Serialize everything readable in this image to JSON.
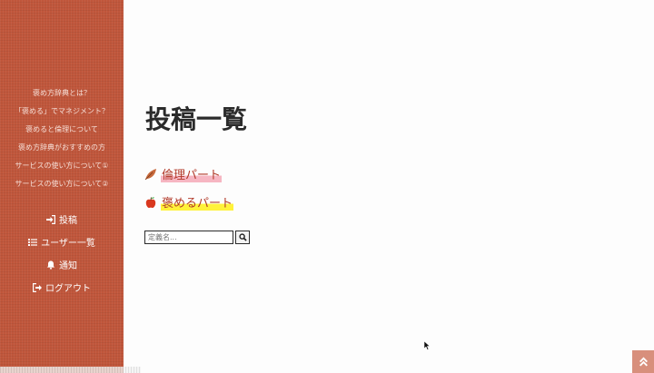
{
  "sidebar": {
    "menu_links": [
      "褒め方辞典とは？",
      "「褒める」でマネジメント？",
      "褒めると倫理について",
      "褒め方辞典がおすすめの方",
      "サービスの使い方について①",
      "サービスの使い方について②"
    ],
    "nav": {
      "post": "投稿",
      "users": "ユーザー一覧",
      "notifications": "通知",
      "logout": "ログアウト"
    }
  },
  "main": {
    "title": "投稿一覧",
    "categories": [
      {
        "label": "倫理パート",
        "icon": "leaf-icon"
      },
      {
        "label": "褒めるパート",
        "icon": "apple-icon"
      }
    ],
    "search": {
      "placeholder": "定義名...",
      "value": ""
    }
  },
  "colors": {
    "sidebar": "#c0563b",
    "link": "#b23a2a",
    "highlight_pink": "#f6b6c2",
    "highlight_yellow": "#fff23a",
    "scroll_top": "#d88f7c"
  }
}
